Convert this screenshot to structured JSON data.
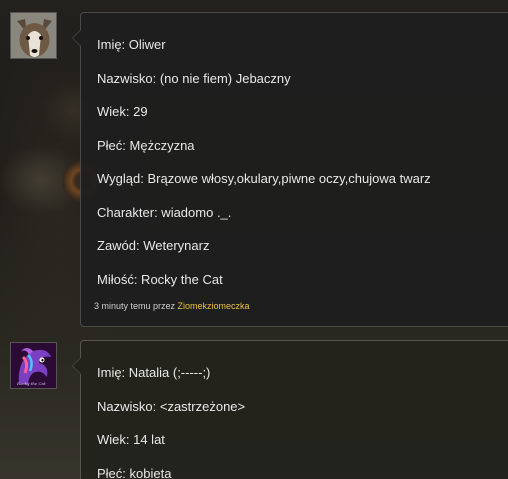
{
  "posts": [
    {
      "avatar_icon": "dog-avatar",
      "lines": [
        "Imię: Oliwer",
        "Nazwisko: (no nie fiem) Jebaczny",
        "Wiek: 29",
        "Płeć: Mężczyzna",
        "Wygląd: Brązowe włosy,okulary,piwne oczy,chujowa twarz",
        "Charakter: wiadomo ._.",
        "Zawód: Weterynarz",
        "Miłość: Rocky the Cat"
      ],
      "meta_prefix": "3 minuty temu przez",
      "author": "Ziomekziomeczka"
    },
    {
      "avatar_icon": "purple-horse-avatar",
      "avatar_caption": "Rocky the Cat",
      "lines": [
        "Imię: Natalia (;-----;)",
        "Nazwisko: <zastrzeżone>",
        "Wiek: 14 lat",
        "Płeć: kobieta"
      ]
    }
  ],
  "colors": {
    "author_link": "#e8c341",
    "post_border": "#4a4a4a",
    "text": "#e8e8e8"
  }
}
